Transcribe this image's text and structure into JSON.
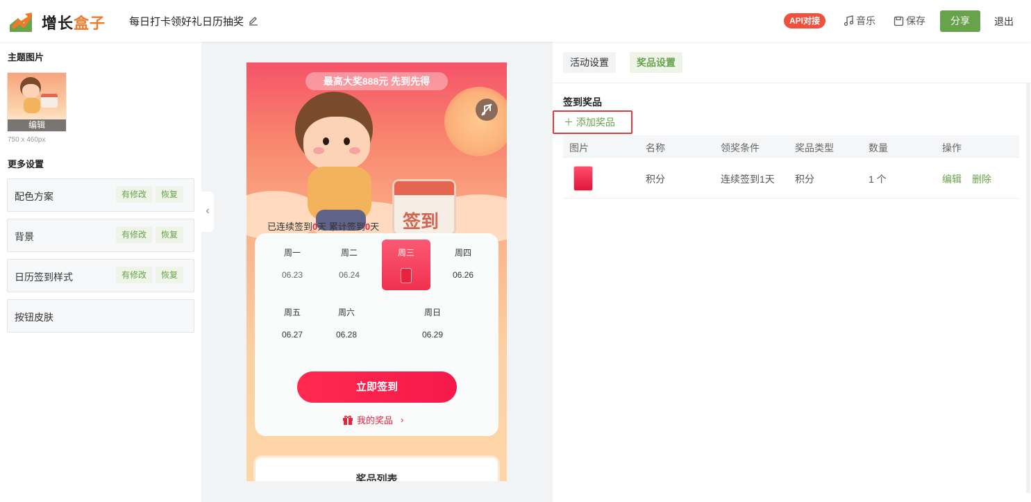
{
  "header": {
    "logo_part1": "增长",
    "logo_part2": "盒子",
    "project_title": "每日打卡领好礼日历抽奖",
    "api_badge": "API对接",
    "music_label": "音乐",
    "save_label": "保存",
    "share_label": "分享",
    "logout_label": "退出",
    "colors": {
      "brand_green": "#67a34a",
      "brand_orange": "#f07a2a",
      "api_red": "#f0513f"
    }
  },
  "left_panel": {
    "theme_image_title": "主题图片",
    "theme_image_edit": "编辑",
    "theme_image_size": "750 x 460px",
    "more_settings_title": "更多设置",
    "settings": [
      {
        "label": "配色方案",
        "modified": "有修改",
        "restore": "恢复"
      },
      {
        "label": "背景",
        "modified": "有修改",
        "restore": "恢复"
      },
      {
        "label": "日历签到样式",
        "modified": "有修改",
        "restore": "恢复"
      },
      {
        "label": "按钮皮肤"
      }
    ]
  },
  "preview": {
    "banner": "最高大奖888元 先到先得",
    "calendar_sign_text": "签到",
    "streak_prefix": "已连续签到",
    "streak_days": "0",
    "streak_unit": "天",
    "total_prefix": "累计签到",
    "total_days": "0",
    "total_unit": "天",
    "days": [
      {
        "weekday": "周一",
        "date": "06.23"
      },
      {
        "weekday": "周二",
        "date": "06.24"
      },
      {
        "weekday": "周三",
        "date": ""
      },
      {
        "weekday": "周四",
        "date": "06.26"
      },
      {
        "weekday": "周五",
        "date": "06.27"
      },
      {
        "weekday": "周六",
        "date": "06.28"
      },
      {
        "weekday": "周日",
        "date": "06.29"
      }
    ],
    "checkin_button": "立即签到",
    "my_prizes": "我的奖品",
    "prize_list_title": "奖品列表"
  },
  "right_panel": {
    "tabs": [
      {
        "label": "活动设置"
      },
      {
        "label": "奖品设置"
      }
    ],
    "section_title": "签到奖品",
    "add_prize": "添加奖品",
    "table": {
      "headers": [
        "图片",
        "名称",
        "领奖条件",
        "奖品类型",
        "数量",
        "操作"
      ],
      "rows": [
        {
          "name": "积分",
          "condition": "连续签到1天",
          "type": "积分",
          "quantity": "1 个",
          "edit": "编辑",
          "delete": "删除"
        }
      ]
    }
  }
}
